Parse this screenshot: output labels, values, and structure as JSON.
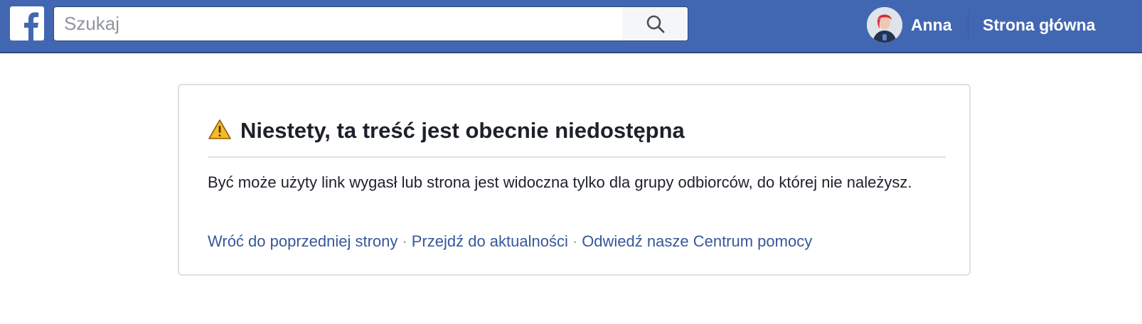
{
  "header": {
    "search": {
      "placeholder": "Szukaj",
      "value": ""
    },
    "profile": {
      "name": "Anna"
    },
    "home_label": "Strona główna"
  },
  "content": {
    "title": "Niestety, ta treść jest obecnie niedostępna",
    "message": "Być może użyty link wygasł lub strona jest widoczna tylko dla grupy odbiorców, do której nie należysz.",
    "links": [
      {
        "label": "Wróć do poprzedniej strony"
      },
      {
        "label": "Przejdź do aktualności"
      },
      {
        "label": "Odwiedź nasze Centrum pomocy"
      }
    ],
    "separator": "·"
  },
  "icons": {
    "logo": "facebook-logo-icon",
    "search": "search-icon",
    "warning": "warning-icon"
  },
  "colors": {
    "brand_blue": "#4267b2",
    "link_blue": "#365899",
    "text_dark": "#1d2129",
    "warning_yellow": "#f7b928"
  }
}
